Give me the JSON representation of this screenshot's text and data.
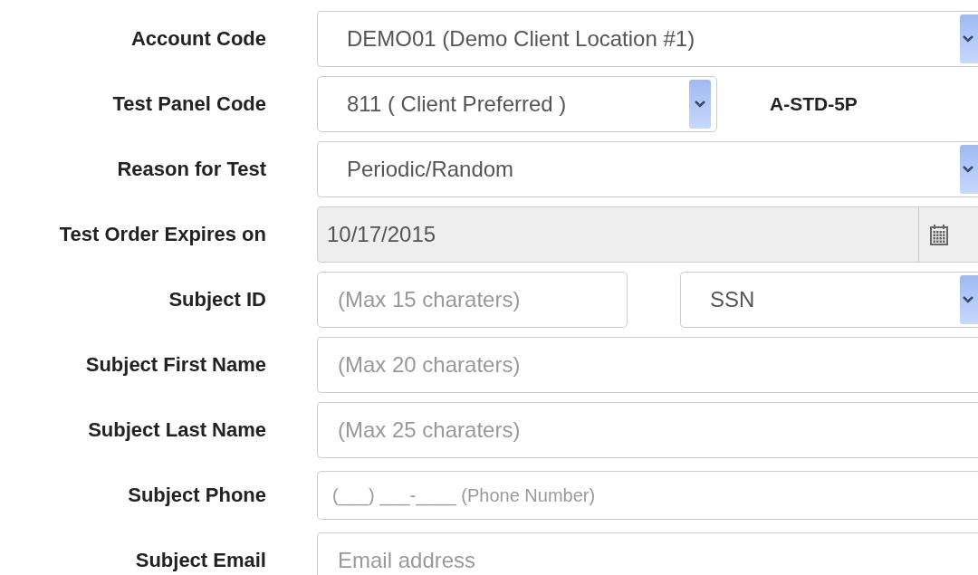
{
  "fields": [
    {
      "label": "Account Code",
      "kind": "select",
      "value": "DEMO01 (Demo Client Location #1)"
    },
    {
      "label": "Test Panel Code",
      "kind": "select-short",
      "value": "811 ( Client Preferred )",
      "note": "A-STD-5P"
    },
    {
      "label": "Reason for Test",
      "kind": "select",
      "value": "Periodic/Random"
    },
    {
      "label": "Test Order Expires on",
      "kind": "date",
      "value": "10/17/2015",
      "disabled": true
    },
    {
      "label": "Subject ID",
      "kind": "input-select",
      "placeholder": "(Max 15 charaters)",
      "option": "SSN"
    },
    {
      "label": "Subject First Name",
      "kind": "input",
      "placeholder": "(Max 20 charaters)"
    },
    {
      "label": "Subject Last Name",
      "kind": "input",
      "placeholder": "(Max 25 charaters)"
    },
    {
      "label": "Subject Phone",
      "kind": "phone",
      "placeholder": "(___) ___-____ (Phone Number)"
    },
    {
      "label": "Subject Email",
      "kind": "input",
      "placeholder": "Email address"
    }
  ]
}
